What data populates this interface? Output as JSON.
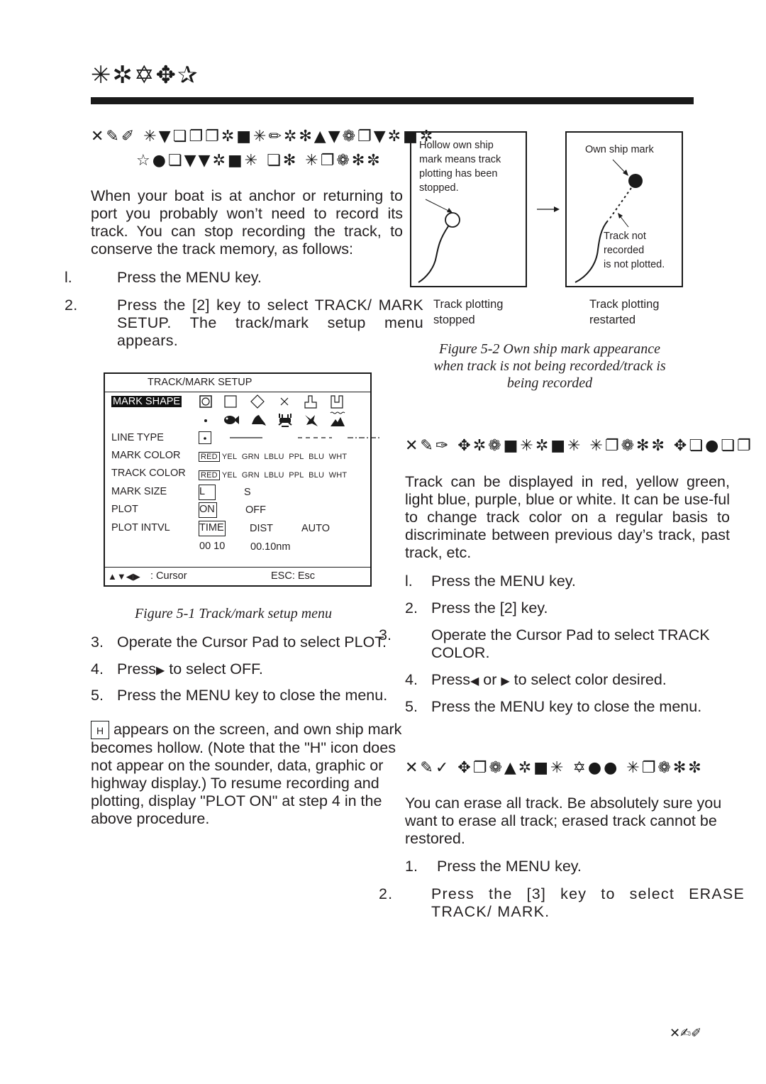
{
  "page": {
    "chapter_title_glyphs": "✳✲✡✥✰",
    "page_number_glyphs": "✕✍✐"
  },
  "left_column": {
    "section_1": {
      "heading_line1": "✕✎✐  ✳▼❏❐❐✲■✳✏✲✻▲▼❁❐▼✲■✲",
      "heading_line2": "☆●❏▼▼✲■✳ ❏✻ ✳❐❁✻✼",
      "intro": "When your boat is at anchor or returning to port you probably won’t need to record its track. You can stop recording the track, to conserve the track memory, as follows:",
      "steps_before": [
        {
          "num": "l.",
          "text": "Press the MENU key."
        },
        {
          "num": "2.",
          "text": "Press the [2] key to select TRACK/ MARK SETUP. The track/mark setup menu appears."
        }
      ],
      "steps_after": [
        {
          "num": "3.",
          "text": "Operate the Cursor Pad to select PLOT."
        },
        {
          "num": "4.",
          "text_before": "Press",
          "text_after": " to select OFF."
        },
        {
          "num": "5.",
          "text": "Press the MENU key to close the menu."
        }
      ],
      "note_icon_label": "H",
      "note": "appears on the screen, and own ship mark becomes hollow. (Note that the \"H\" icon does not appear on the sounder, data, graphic or highway display.) To resume recording and plotting, display \"PLOT ON\" at step 4 in the above procedure."
    },
    "figure_5_1": {
      "caption": "Figure 5-1 Track/mark setup menu",
      "menu": {
        "title": "TRACK/MARK SETUP",
        "rows": [
          {
            "label": "MARK SHAPE",
            "selected": true
          },
          {
            "label": "LINE TYPE"
          },
          {
            "label": "MARK COLOR"
          },
          {
            "label": "TRACK COLOR"
          },
          {
            "label": "MARK SIZE"
          },
          {
            "label": "PLOT"
          },
          {
            "label": "PLOT INTVL"
          }
        ],
        "mark_shapes_row1": [
          "circle-in-square",
          "square",
          "diamond",
          "cross",
          "flag-up",
          "flag-down"
        ],
        "mark_shapes_row2": [
          "dot",
          "fish",
          "whale",
          "crab",
          "bird",
          "wave-mountain"
        ],
        "line_types": [
          "dotted",
          "solid",
          "dashed",
          "dash-dot"
        ],
        "colors": [
          "RED",
          "YEL",
          "GRN",
          "LBLU",
          "PPL",
          "BLU",
          "WHT"
        ],
        "mark_color_selected": "RED",
        "track_color_selected": "RED",
        "mark_size_options": [
          "L",
          "S"
        ],
        "mark_size_selected": "L",
        "plot_options": [
          "ON",
          "OFF"
        ],
        "plot_selected": "ON",
        "plot_intvl_options": [
          "TIME",
          "DIST",
          "AUTO"
        ],
        "plot_intvl_selected": "TIME",
        "time_value": "00 10",
        "dist_value": "00.10nm",
        "footer_left": ": Cursor",
        "footer_arrows": "▲▼◀▶",
        "footer_right": "ESC: Esc"
      }
    }
  },
  "right_column": {
    "figure_5_2": {
      "panel_left": {
        "note": [
          "Hollow own ship",
          "mark means track",
          "plotting has been",
          "stopped."
        ],
        "label": [
          "Track plotting",
          "stopped"
        ]
      },
      "panel_right": {
        "note_top": "Own ship mark",
        "note_bottom": [
          "Track not",
          "recorded",
          "is not plotted."
        ],
        "label": [
          "Track plotting",
          "restarted"
        ]
      },
      "caption": [
        "Figure 5-2 Own ship mark appearance",
        "when track is not being recorded/track is",
        "being recorded"
      ]
    },
    "section_2": {
      "heading": "✕✎✑  ✥✲❁■✳✲■✳ ✳❐❁✻✼ ✥❏●❏❐",
      "intro": "Track can be displayed in red, yellow green, light blue, purple, blue or white. It can be use-ful to change track color on a regular basis to discriminate between previous day’s track, past track, etc.",
      "steps": [
        {
          "num": "l.",
          "text": "Press the MENU key."
        },
        {
          "num": "2.",
          "text": "Press the [2] key."
        },
        {
          "num": "3.",
          "text": "Operate the Cursor Pad to select TRACK COLOR."
        },
        {
          "num": "4.",
          "text_before": "Press",
          "text_middle": " or ",
          "text_after": " to select color desired."
        },
        {
          "num": "5.",
          "text": "Press the MENU key to close the menu."
        }
      ]
    },
    "section_3": {
      "heading": "✕✎✓  ✥❐❁▲✲■✳ ✡●● ✳❐❁✻✼",
      "intro": "You can erase all track. Be absolutely sure you want to erase all track; erased track cannot be restored.",
      "steps": [
        {
          "num": "1.",
          "text": "Press the MENU key."
        },
        {
          "num": "2.",
          "text": "Press the [3] key to select ERASE TRACK/ MARK."
        }
      ]
    }
  }
}
